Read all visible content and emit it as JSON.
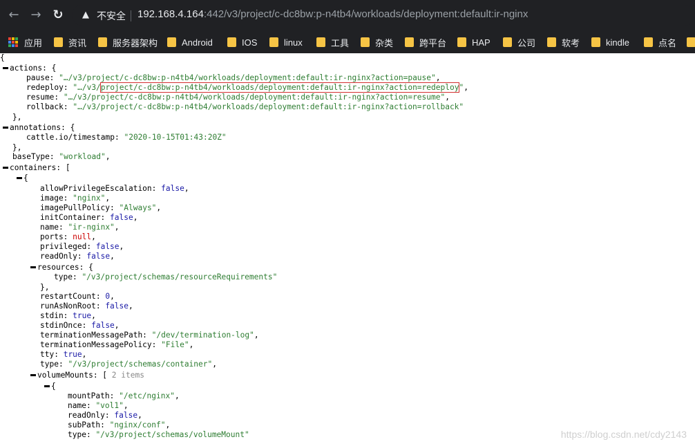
{
  "browser": {
    "security_label": "不安全",
    "url_host": "192.168.4.164",
    "url_rest": ":442/v3/project/c-dc8bw:p-n4tb4/workloads/deployment:default:ir-nginx",
    "back_icon": "arrow-left-icon",
    "forward_icon": "arrow-right-icon",
    "reload_icon": "reload-icon"
  },
  "bookmarks": {
    "apps": "应用",
    "items": [
      "资讯",
      "服务器架构",
      "Android",
      "IOS",
      "linux",
      "工具",
      "杂类",
      "跨平台",
      "HAP",
      "公司",
      "软考",
      "kindle",
      "点名"
    ]
  },
  "json": {
    "open_brace": "{",
    "actions_key": "actions:",
    "actions_open": " {",
    "pause_key": "pause:",
    "pause_val": "\"…/v3/project/c-dc8bw:p-n4tb4/workloads/deployment:default:ir-nginx?action=pause\"",
    "redeploy_key": "redeploy:",
    "redeploy_val_a": "\"…/v3/",
    "redeploy_val_b": "project/c-dc8bw:p-n4tb4/workloads/deployment:default:ir-nginx?action=redeploy",
    "redeploy_val_c": "\"",
    "resume_key": "resume:",
    "resume_val": "\"…/v3/project/c-dc8bw:p-n4tb4/workloads/deployment:default:ir-nginx?action=resume\"",
    "rollback_key": "rollback:",
    "rollback_val": "\"…/v3/project/c-dc8bw:p-n4tb4/workloads/deployment:default:ir-nginx?action=rollback\"",
    "close_obj": "},",
    "annotations_key": "annotations:",
    "timestamp_key": "cattle.io/timestamp:",
    "timestamp_val": "\"2020-10-15T01:43:20Z\"",
    "basetype_key": "baseType:",
    "basetype_val": "\"workload\"",
    "containers_key": "containers:",
    "containers_open": " [",
    "item_open": "{",
    "ape_key": "allowPrivilegeEscalation:",
    "ape_val": "false",
    "image_key": "image:",
    "image_val": "\"nginx\"",
    "ipp_key": "imagePullPolicy:",
    "ipp_val": "\"Always\"",
    "init_key": "initContainer:",
    "init_val": "false",
    "name_key": "name:",
    "name_val": "\"ir-nginx\"",
    "ports_key": "ports:",
    "ports_val": "null",
    "priv_key": "privileged:",
    "priv_val": "false",
    "ro_key": "readOnly:",
    "ro_val": "false",
    "res_key": "resources:",
    "res_type_key": "type:",
    "res_type_val": "\"/v3/project/schemas/resourceRequirements\"",
    "restart_key": "restartCount:",
    "restart_val": "0",
    "ranr_key": "runAsNonRoot:",
    "ranr_val": "false",
    "stdin_key": "stdin:",
    "stdin_val": "true",
    "stdinonce_key": "stdinOnce:",
    "stdinonce_val": "false",
    "tmp_key": "terminationMessagePath:",
    "tmp_val": "\"/dev/termination-log\"",
    "tmpol_key": "terminationMessagePolicy:",
    "tmpol_val": "\"File\"",
    "tty_key": "tty:",
    "tty_val": "true",
    "ctype_key": "type:",
    "ctype_val": "\"/v3/project/schemas/container\"",
    "vm_key": "volumeMounts:",
    "vm_open": " [",
    "vm_count": "2 items",
    "mp_key": "mountPath:",
    "mp_val": "\"/etc/nginx\"",
    "vname_key": "name:",
    "vname_val": "\"vol1\"",
    "vro_key": "readOnly:",
    "vro_val": "false",
    "sub_key": "subPath:",
    "sub_val": "\"nginx/conf\"",
    "vtype_key": "type:",
    "vtype_val": "\"/v3/project/schemas/volumeMount\""
  },
  "watermark": "https://blog.csdn.net/cdy2143"
}
